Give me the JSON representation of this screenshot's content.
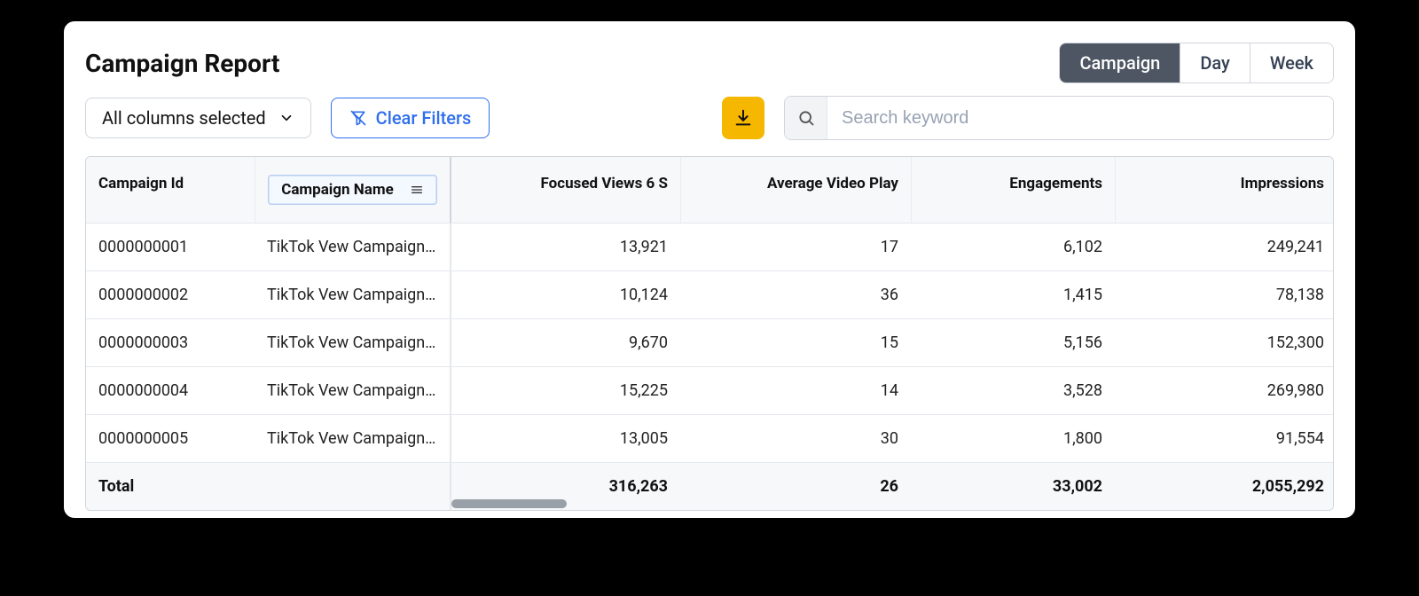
{
  "title": "Campaign Report",
  "segments": {
    "campaign": "Campaign",
    "day": "Day",
    "week": "Week",
    "active": "campaign"
  },
  "toolbar": {
    "columns_label": "All columns selected",
    "clear_label": "Clear Filters",
    "search_placeholder": "Search keyword"
  },
  "columns": {
    "id": "Campaign Id",
    "name": "Campaign Name",
    "focused": "Focused Views 6 S",
    "avgplay": "Average Video Play",
    "engagements": "Engagements",
    "impressions": "Impressions"
  },
  "rows": [
    {
      "id": "0000000001",
      "name": "TikTok Vew Campaign A",
      "focused": "13,921",
      "avgplay": "17",
      "engagements": "6,102",
      "impressions": "249,241"
    },
    {
      "id": "0000000002",
      "name": "TikTok Vew Campaign B",
      "focused": "10,124",
      "avgplay": "36",
      "engagements": "1,415",
      "impressions": "78,138"
    },
    {
      "id": "0000000003",
      "name": "TikTok Vew Campaign c",
      "focused": "9,670",
      "avgplay": "15",
      "engagements": "5,156",
      "impressions": "152,300"
    },
    {
      "id": "0000000004",
      "name": "TikTok Vew Campaign D",
      "focused": "15,225",
      "avgplay": "14",
      "engagements": "3,528",
      "impressions": "269,980"
    },
    {
      "id": "0000000005",
      "name": "TikTok Vew Campaign E",
      "focused": "13,005",
      "avgplay": "30",
      "engagements": "1,800",
      "impressions": "91,554"
    }
  ],
  "totals": {
    "label": "Total",
    "focused": "316,263",
    "avgplay": "26",
    "engagements": "33,002",
    "impressions": "2,055,292"
  }
}
